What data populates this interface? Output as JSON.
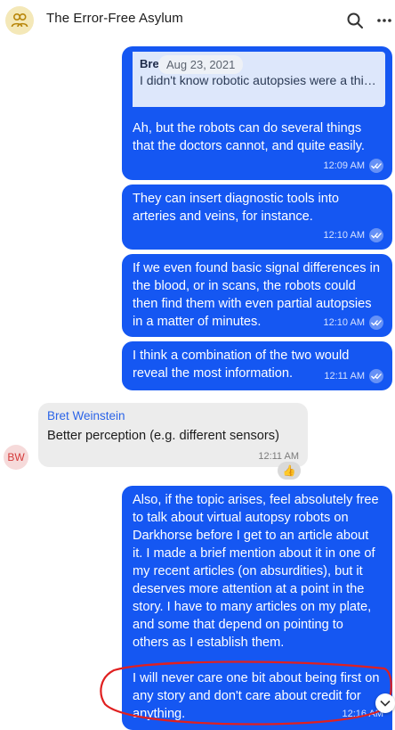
{
  "header": {
    "title": "The Error-Free Asylum",
    "group_icon": "users-icon",
    "search_icon": "search-icon",
    "more_icon": "more-icon"
  },
  "date_separator": "Aug 23, 2021",
  "messages": [
    {
      "reply_to": {
        "author": "Bret Weinstein",
        "text": "I didn't know robotic autopsies were a thing. And I'll bet they're no substitute f..."
      },
      "text": "Ah, but the robots can do several things that the doctors cannot, and quite easily.",
      "time": "12:09 AM"
    },
    {
      "text": "They can insert diagnostic tools into arteries and veins, for instance.",
      "time": "12:10 AM"
    },
    {
      "text": "If we even found basic signal differences in the blood, or in scans, the robots could then find them with even partial autopsies in a matter of minutes.",
      "time": "12:10 AM"
    },
    {
      "text": "I think a combination of the two would reveal the most information.",
      "time": "12:11 AM"
    },
    {
      "author": "Bret Weinstein",
      "text": "Better perception (e.g. different sensors)",
      "time": "12:11 AM",
      "avatar_initials": "BW",
      "reaction": "👍"
    },
    {
      "text": "Also, if the topic arises, feel absolutely free to talk about virtual autopsy robots on Darkhorse before I get to an article about it. I made a brief mention about it in one of my recent articles (on absurdities), but it deserves more attention at a point in the story. I have to many articles on my plate, and some that depend on pointing to others as I establish them.",
      "text2": "I will never care one bit about being first on any story and don't care about credit for anything.",
      "time": "12:16 AM"
    }
  ],
  "colors": {
    "outgoing_bubble": "#1557f2",
    "incoming_bubble": "#ececec",
    "author_name": "#2b64e8",
    "annotation": "#e02020"
  }
}
